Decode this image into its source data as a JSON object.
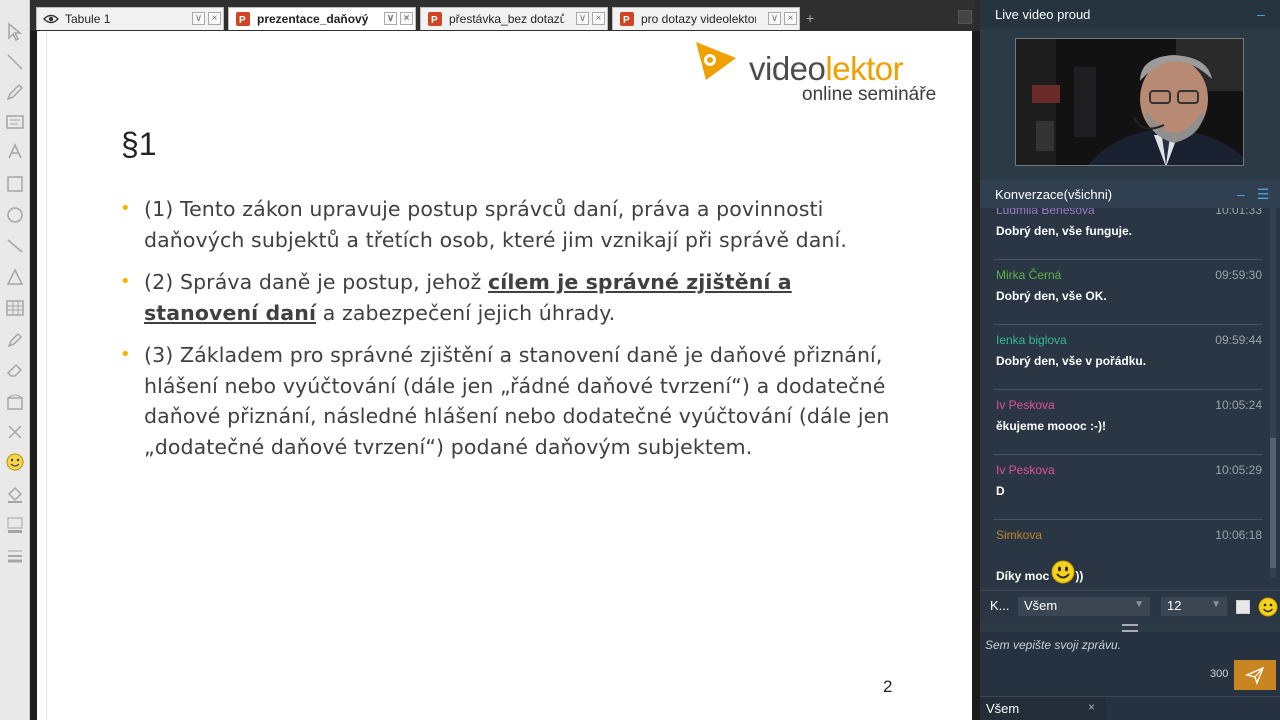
{
  "tabs": [
    {
      "label": "Tabule 1",
      "icon": "eye-icon",
      "active": false
    },
    {
      "label": "prezentace_daňový",
      "icon": "powerpoint-icon",
      "active": true
    },
    {
      "label": "přestávka_bez dotazů",
      "icon": "powerpoint-icon",
      "active": false
    },
    {
      "label": "pro dotazy videolektor",
      "icon": "powerpoint-icon",
      "active": false
    }
  ],
  "tab_controls": {
    "minimize": "∨",
    "close": "×",
    "add": "+"
  },
  "slide": {
    "logo_video": "video",
    "logo_lektor": "lektor",
    "logo_sub": "online semináře",
    "title": "§1",
    "bullet_char": "•",
    "b1": "(1) Tento zákon upravuje postup správců daní, práva a povinnosti daňových subjektů a třetích osob, které jim vznikají při správě daní.",
    "b2_pre": "(2) Správa daně je postup, jehož ",
    "b2_emph": "cílem je správné zjištění a stanovení daní",
    "b2_post": " a zabezpečení jejich úhrady.",
    "b3": "(3) Základem pro správné zjištění a stanovení daně je daňové přiznání, hlášení nebo vyúčtování (dále jen „řádné daňové tvrzení“) a dodatečné daňové přiznání, následné hlášení nebo dodatečné vyúčtování (dále jen „dodatečné daňové tvrzení“) podané daňovým subjektem.",
    "page_number": "2"
  },
  "video_panel": {
    "title": "Live video proud"
  },
  "chat_panel": {
    "title": "Konverzace(všichni)",
    "minimize": "–",
    "menu": "☰"
  },
  "messages": [
    {
      "name": "Ludmila Benešová",
      "time": "10:01:33",
      "text": "Dobrý den, vše funguje.",
      "color": "#9a7bc4"
    },
    {
      "name": "Mirka Černá",
      "time": "09:59:30",
      "text": "Dobrý den, vše OK.",
      "color": "#5fb04a"
    },
    {
      "name": "Ienka biglova",
      "time": "09:59:44",
      "text": "Dobrý den, vše v pořádku.",
      "color": "#36b89a"
    },
    {
      "name": "Iv Peskova",
      "time": "10:05:24",
      "text": "ěkujeme moooc :-)!",
      "color": "#e0509a"
    },
    {
      "name": "Iv Peskova",
      "time": "10:05:29",
      "text": "D",
      "color": "#e0509a"
    },
    {
      "name": "Simkova",
      "time": "10:06:18",
      "text": "Díky moc",
      "text_after": "))",
      "color": "#b8862e"
    }
  ],
  "compose": {
    "to_label": "K...",
    "recipient": "Všem",
    "font_size": "12",
    "placeholder": "Sem vepište svoji zprávu.",
    "char_count": "300",
    "bottom_tab": "Všem",
    "bottom_tab_close": "×"
  },
  "colors": {
    "accent_orange": "#f0a000",
    "panel_bg": "#2c3a46",
    "send_button": "#c98620"
  }
}
